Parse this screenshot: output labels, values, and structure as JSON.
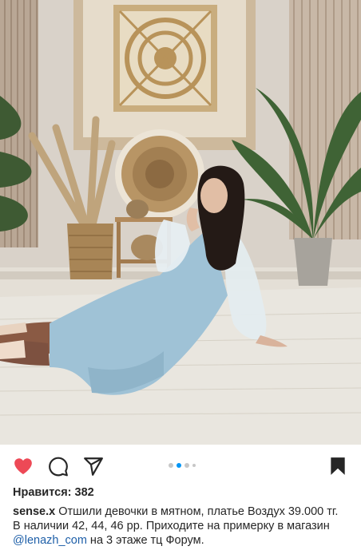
{
  "post": {
    "image_alt": "Woman in mint dress sitting on a rug",
    "slide_count": 4,
    "active_slide": 2,
    "likes_label": "Нравится: 382",
    "caption": {
      "username": "sense.x",
      "text_part1": " Отшили девочки в мятном, платье Воздух 39.000 тг. В наличии 42, 44, 46 рр. Приходите на примерку в магазин ",
      "mention": "@lenazh_com",
      "text_part2": " на 3 этаже тц Форум."
    }
  },
  "actions": {
    "like_icon": "heart-filled-icon",
    "comment_icon": "comment-bubble-icon",
    "share_icon": "paper-plane-icon",
    "save_icon": "bookmark-filled-icon",
    "like_color": "#ed4956"
  }
}
